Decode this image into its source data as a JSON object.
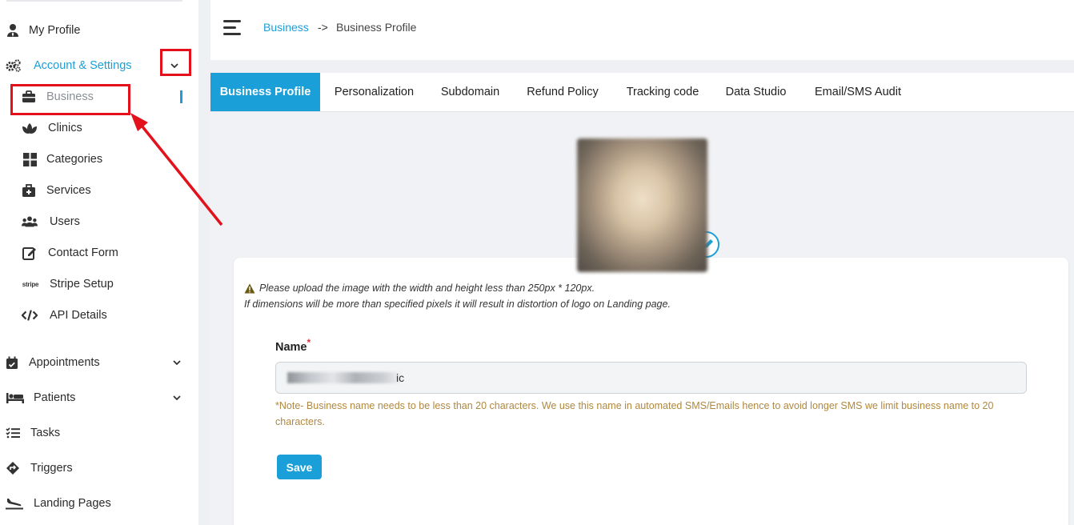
{
  "sidebar": {
    "items": [
      {
        "label": "My Profile",
        "icon": "user-tie-icon"
      },
      {
        "label": "Account & Settings",
        "icon": "cogs-icon"
      },
      {
        "label": "Business",
        "icon": "briefcase-icon"
      },
      {
        "label": "Clinics",
        "icon": "lotus-icon"
      },
      {
        "label": "Categories",
        "icon": "grid-icon"
      },
      {
        "label": "Services",
        "icon": "medkit-icon"
      },
      {
        "label": "Users",
        "icon": "users-icon"
      },
      {
        "label": "Contact Form",
        "icon": "edit-icon"
      },
      {
        "label": "Stripe Setup",
        "icon_text": "stripe"
      },
      {
        "label": "API Details",
        "icon": "code-icon"
      },
      {
        "label": "Appointments",
        "icon": "calendar-check-icon"
      },
      {
        "label": "Patients",
        "icon": "bed-icon"
      },
      {
        "label": "Tasks",
        "icon": "list-check-icon"
      },
      {
        "label": "Triggers",
        "icon": "diamond-arrow-icon"
      },
      {
        "label": "Landing Pages",
        "icon": "plane-landing-icon"
      }
    ]
  },
  "breadcrumb": {
    "link": "Business",
    "separator": "->",
    "current": "Business Profile"
  },
  "tabs": [
    {
      "label": "Business Profile"
    },
    {
      "label": "Personalization"
    },
    {
      "label": "Subdomain"
    },
    {
      "label": "Refund Policy"
    },
    {
      "label": "Tracking code"
    },
    {
      "label": "Data Studio"
    },
    {
      "label": "Email/SMS Audit"
    }
  ],
  "form": {
    "warning_line1": "Please upload the image with the width and height less than 250px * 120px.",
    "warning_line2": "If dimensions will be more than specified pixels it will result in distortion of logo on Landing page.",
    "name_label": "Name",
    "required_mark": "*",
    "name_value_visible": "ic",
    "note": "*Note- Business name needs to be less than 20 characters. We use this name in automated SMS/Emails hence to avoid longer SMS we limit business name to 20 characters.",
    "save_label": "Save"
  },
  "colors": {
    "accent": "#1a9fd9",
    "note": "#b0883f",
    "annotation": "#e3111b"
  }
}
